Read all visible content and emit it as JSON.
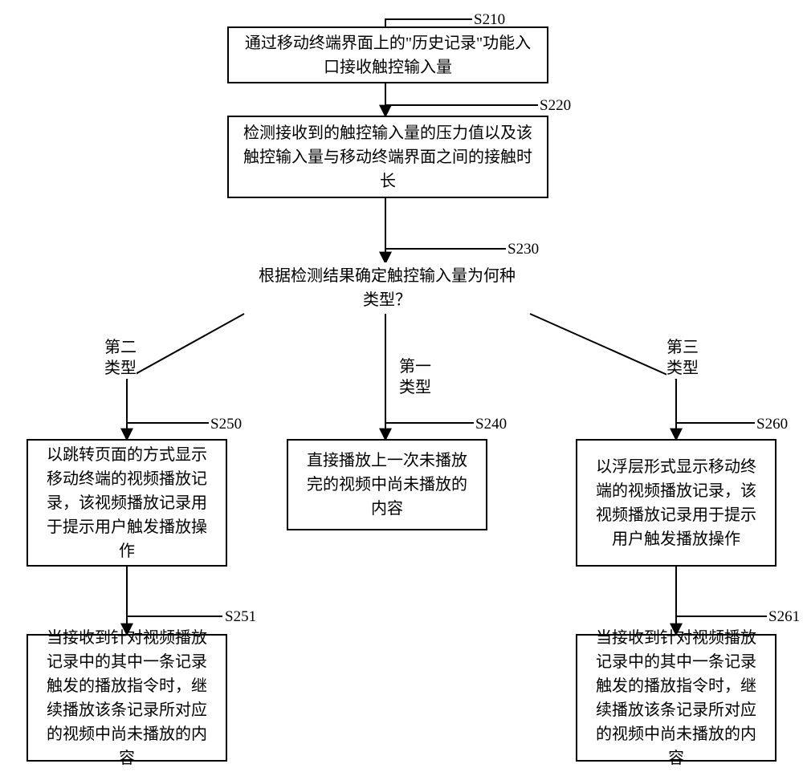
{
  "steps": {
    "s210": {
      "label": "S210",
      "text": "通过移动终端界面上的\"历史记录\"功能入口接收触控输入量"
    },
    "s220": {
      "label": "S220",
      "text": "检测接收到的触控输入量的压力值以及该触控输入量与移动终端界面之间的接触时长"
    },
    "s230": {
      "label": "S230",
      "text": "根据检测结果确定触控输入量为何种类型？"
    },
    "s240": {
      "label": "S240",
      "text": "直接播放上一次未播放完的视频中尚未播放的内容"
    },
    "s250": {
      "label": "S250",
      "text": "以跳转页面的方式显示移动终端的视频播放记录，该视频播放记录用于提示用户触发播放操作"
    },
    "s251": {
      "label": "S251",
      "text": "当接收到针对视频播放记录中的其中一条记录触发的播放指令时，继续播放该条记录所对应的视频中尚未播放的内容"
    },
    "s260": {
      "label": "S260",
      "text": "以浮层形式显示移动终端的视频播放记录，该视频播放记录用于提示用户触发播放操作"
    },
    "s261": {
      "label": "S261",
      "text": "当接收到针对视频播放记录中的其中一条记录触发的播放指令时，继续播放该条记录所对应的视频中尚未播放的内容"
    }
  },
  "branches": {
    "type1": "第一\n类型",
    "type2": "第二\n类型",
    "type3": "第三\n类型"
  }
}
